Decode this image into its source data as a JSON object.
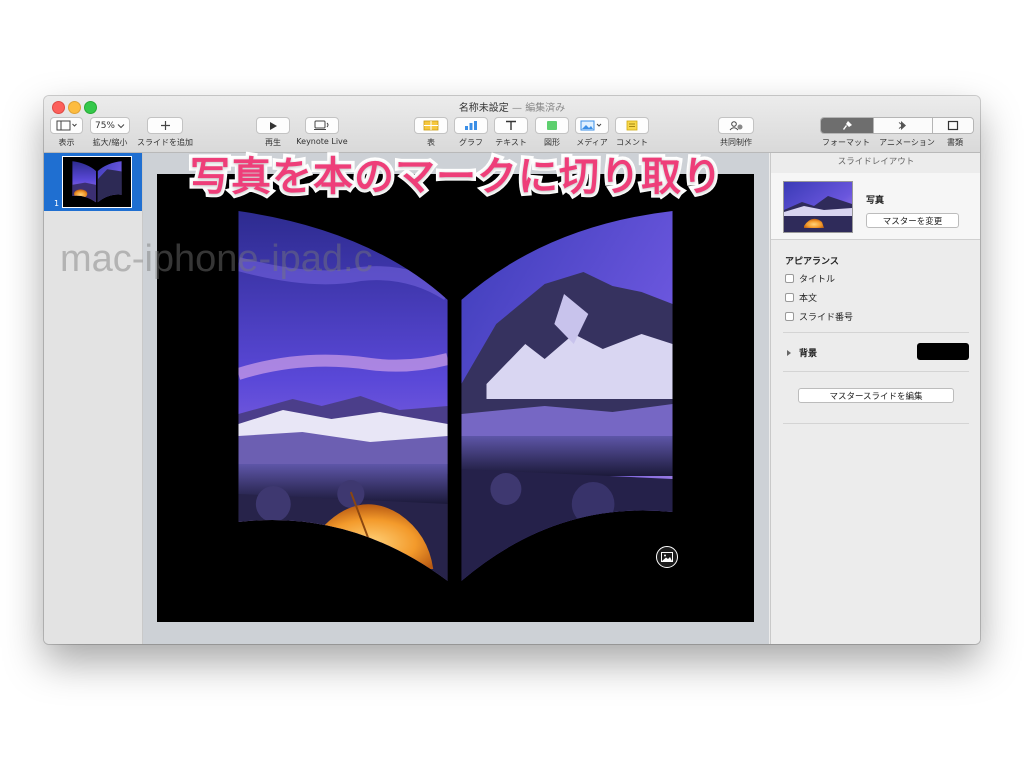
{
  "window": {
    "title": "名称未設定",
    "title_separator": "—",
    "edited_label": "編集済み"
  },
  "toolbar": {
    "view_label": "表示",
    "zoom_value": "75%",
    "zoom_label": "拡大/縮小",
    "add_slide_label": "スライドを追加",
    "play_label": "再生",
    "keynote_live_label": "Keynote Live",
    "table_label": "表",
    "chart_label": "グラフ",
    "text_label": "テキスト",
    "shape_label": "図形",
    "media_label": "メディア",
    "comment_label": "コメント",
    "collaborate_label": "共同制作",
    "format_label": "フォーマット",
    "animate_label": "アニメーション",
    "document_label": "書類"
  },
  "navigator": {
    "slides": [
      {
        "number": "1"
      }
    ]
  },
  "inspector": {
    "header": "スライドレイアウト",
    "master_name": "写真",
    "change_master_button": "マスターを変更",
    "appearance_title": "アピアランス",
    "checkboxes": [
      {
        "label": "タイトル",
        "checked": false
      },
      {
        "label": "本文",
        "checked": false
      },
      {
        "label": "スライド番号",
        "checked": false
      }
    ],
    "background_label": "背景",
    "background_color": "#000000",
    "edit_master_button": "マスタースライドを編集"
  },
  "overlay": {
    "headline": "写真を本のマークに切り取り",
    "watermark": "mac-iphone-ipad.c"
  },
  "colors": {
    "accent_blue": "#1f6fd1",
    "headline_pink": "#ee3e79",
    "sky_purple": "#5a48d8"
  },
  "icons": {
    "media_placeholder": "image-icon"
  }
}
